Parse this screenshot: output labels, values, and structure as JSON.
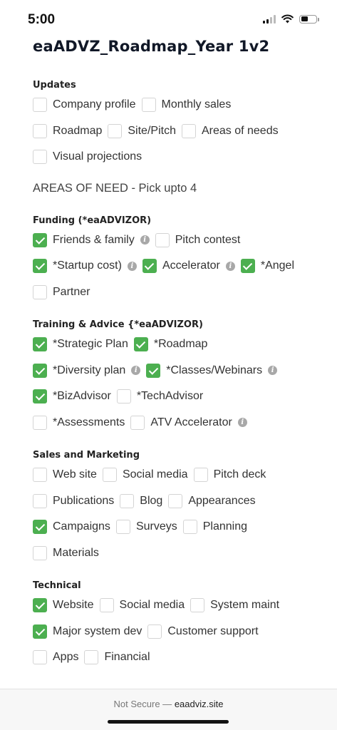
{
  "status": {
    "time": "5:00"
  },
  "title": "eaADVZ_Roadmap_Year 1v2",
  "updates": {
    "heading": "Updates",
    "rows": [
      [
        {
          "label": "Company profile",
          "checked": false
        },
        {
          "label": "Monthly sales",
          "checked": false
        }
      ],
      [
        {
          "label": "Roadmap",
          "checked": false
        },
        {
          "label": "Site/Pitch",
          "checked": false
        },
        {
          "label": "Areas of needs",
          "checked": false
        }
      ],
      [
        {
          "label": "Visual projections",
          "checked": false
        }
      ]
    ]
  },
  "areas_heading": "AREAS OF NEED - Pick upto 4",
  "funding": {
    "heading": "Funding (*eaADVIZOR)",
    "rows": [
      [
        {
          "label": "Friends & family",
          "checked": true,
          "info": true
        },
        {
          "label": "Pitch contest",
          "checked": false
        }
      ],
      [
        {
          "label": "*Startup cost)",
          "checked": true,
          "info": true
        },
        {
          "label": "Accelerator",
          "checked": true,
          "info": true
        },
        {
          "label": "*Angel",
          "checked": true
        }
      ],
      [
        {
          "label": "Partner",
          "checked": false
        }
      ]
    ]
  },
  "training": {
    "heading": "Training & Advice {*eaADVIZOR)",
    "rows": [
      [
        {
          "label": "*Strategic Plan",
          "checked": true
        },
        {
          "label": "*Roadmap",
          "checked": true
        }
      ],
      [
        {
          "label": "*Diversity plan",
          "checked": true,
          "info": true
        },
        {
          "label": "*Classes/Webinars",
          "checked": true,
          "info": true
        }
      ],
      [
        {
          "label": "*BizAdvisor",
          "checked": true
        },
        {
          "label": "*TechAdvisor",
          "checked": false
        }
      ],
      [
        {
          "label": "*Assessments",
          "checked": false
        },
        {
          "label": "ATV Accelerator",
          "checked": false,
          "info": true
        }
      ]
    ]
  },
  "sales": {
    "heading": "Sales and Marketing",
    "rows": [
      [
        {
          "label": "Web site",
          "checked": false
        },
        {
          "label": "Social media",
          "checked": false
        },
        {
          "label": "Pitch deck",
          "checked": false
        }
      ],
      [
        {
          "label": "Publications",
          "checked": false
        },
        {
          "label": "Blog",
          "checked": false
        },
        {
          "label": "Appearances",
          "checked": false
        }
      ],
      [
        {
          "label": "Campaigns",
          "checked": true
        },
        {
          "label": "Surveys",
          "checked": false
        },
        {
          "label": "Planning",
          "checked": false
        }
      ],
      [
        {
          "label": "Materials",
          "checked": false
        }
      ]
    ]
  },
  "technical": {
    "heading": "Technical",
    "rows": [
      [
        {
          "label": "Website",
          "checked": true
        },
        {
          "label": "Social media",
          "checked": false
        },
        {
          "label": "System maint",
          "checked": false
        }
      ],
      [
        {
          "label": "Major system dev",
          "checked": true
        },
        {
          "label": "Customer support",
          "checked": false
        }
      ],
      [
        {
          "label": "Apps",
          "checked": false
        },
        {
          "label": "Financial",
          "checked": false
        }
      ]
    ]
  },
  "browser": {
    "not_secure": "Not Secure —",
    "domain": "eaadviz.site"
  },
  "colors": {
    "checked": "#4caf50",
    "title": "#111827"
  },
  "icons": {
    "info": "info-icon",
    "signal": "cellular-signal-icon",
    "wifi": "wifi-icon",
    "battery": "battery-icon"
  }
}
